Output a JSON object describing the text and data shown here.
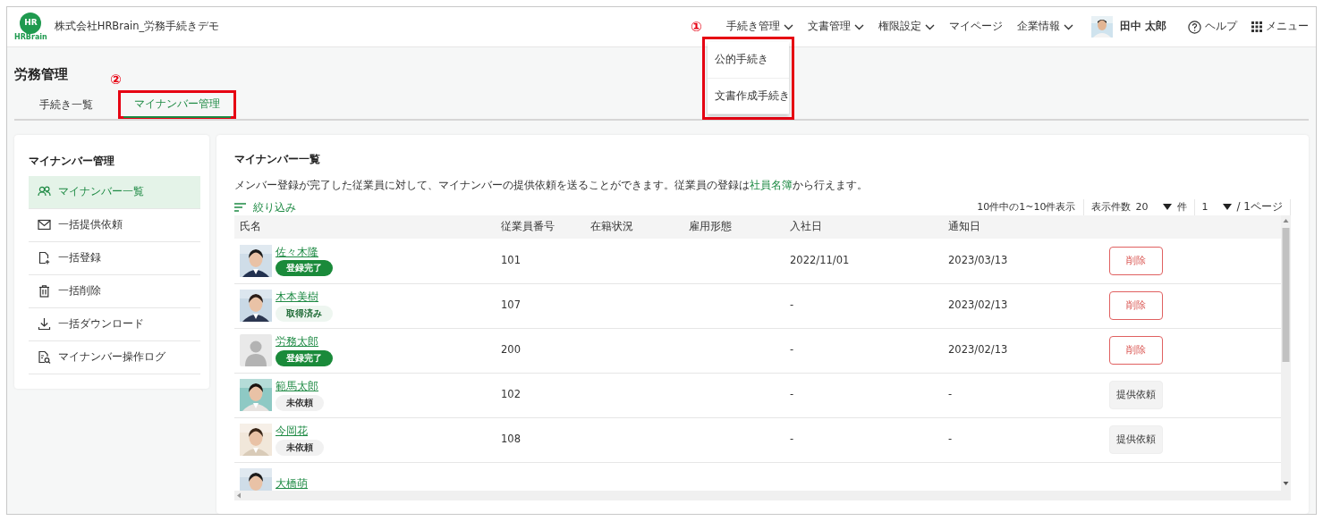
{
  "header": {
    "logo": {
      "mark": "HR",
      "wordmark": "HRBrain"
    },
    "company": "株式会社HRBrain_労務手続きデモ",
    "nav": [
      {
        "label": "手続き管理",
        "has_menu": true,
        "menu": [
          "公的手続き",
          "文書作成手続き"
        ]
      },
      {
        "label": "文書管理",
        "has_menu": true
      },
      {
        "label": "権限設定",
        "has_menu": true
      },
      {
        "label": "マイページ",
        "has_menu": false
      },
      {
        "label": "企業情報",
        "has_menu": true
      }
    ],
    "user": {
      "name": "田中 太郎"
    },
    "help": "ヘルプ",
    "menu": "メニュー"
  },
  "page_title": "労務管理",
  "tabs": [
    {
      "label": "手続き一覧",
      "selected": false
    },
    {
      "label": "マイナンバー管理",
      "selected": true
    }
  ],
  "annotations": [
    {
      "label": "①"
    },
    {
      "label": "②"
    }
  ],
  "sidebar": {
    "title": "マイナンバー管理",
    "items": [
      {
        "label": "マイナンバー一覧",
        "selected": true
      },
      {
        "label": "一括提供依頼",
        "selected": false
      },
      {
        "label": "一括登録",
        "selected": false
      },
      {
        "label": "一括削除",
        "selected": false
      },
      {
        "label": "一括ダウンロード",
        "selected": false
      },
      {
        "label": "マイナンバー操作ログ",
        "selected": false
      }
    ]
  },
  "panel": {
    "title": "マイナンバー一覧",
    "description": "メンバー登録が完了した従業員に対して、マイナンバーの提供依頼を送ることができます。従業員の登録は",
    "link": "社員名簿",
    "description_end": "から行えます。",
    "filter": "絞り込み",
    "count": "10件中の1~10件表示",
    "per_page_label": "表示件数",
    "per_page": "20",
    "per_page_unit": "件",
    "page": "1",
    "page_total": "/ 1ページ"
  },
  "table": {
    "columns": [
      "氏名",
      "従業員番号",
      "在籍状況",
      "雇用形態",
      "入社日",
      "通知日"
    ],
    "rows": [
      {
        "name": "佐々木隆",
        "status": {
          "label": "登録完了",
          "kind": "done"
        },
        "employee_no": "101",
        "hire_date": "2022/11/01",
        "notified": "2023/03/13",
        "action": {
          "label": "削除",
          "kind": "delete"
        }
      },
      {
        "name": "木本美樹",
        "status": {
          "label": "取得済み",
          "kind": "acquired"
        },
        "employee_no": "107",
        "hire_date": "-",
        "notified": "2023/02/13",
        "action": {
          "label": "削除",
          "kind": "delete"
        }
      },
      {
        "kind": "placeholder",
        "name": "労務太郎",
        "status": {
          "label": "登録完了",
          "kind": "done"
        },
        "employee_no": "200",
        "hire_date": "-",
        "notified": "2023/02/13",
        "action": {
          "label": "削除",
          "kind": "delete"
        }
      },
      {
        "name": "範馬太郎",
        "status": {
          "label": "未依頼",
          "kind": "pending"
        },
        "employee_no": "102",
        "hire_date": "-",
        "notified": "-",
        "action": {
          "label": "提供依頼",
          "kind": "request"
        }
      },
      {
        "name": "今岡花",
        "status": {
          "label": "未依頼",
          "kind": "pending"
        },
        "employee_no": "108",
        "hire_date": "-",
        "notified": "-",
        "action": {
          "label": "提供依頼",
          "kind": "request"
        }
      },
      {
        "name": "大橋萌"
      }
    ]
  }
}
